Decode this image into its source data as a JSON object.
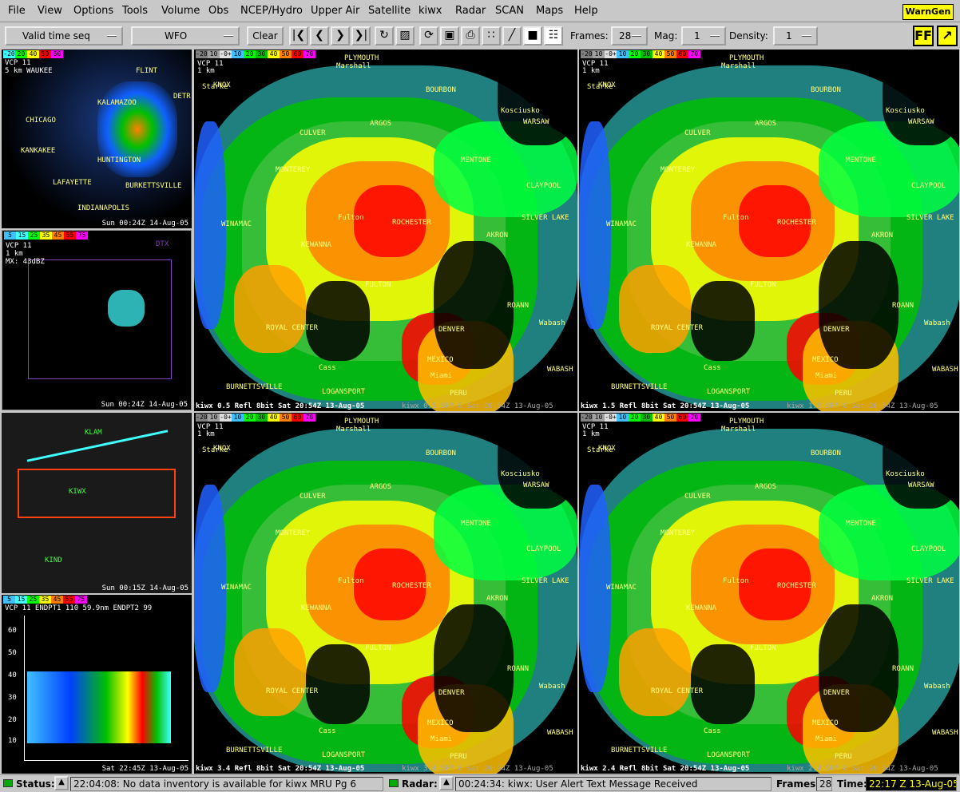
{
  "menu": [
    "File",
    "View",
    "Options",
    "Tools",
    "Volume",
    "Obs",
    "NCEP/Hydro",
    "Upper Air",
    "Satellite",
    "kiwx",
    "Radar",
    "SCAN",
    "Maps",
    "Help"
  ],
  "warngen": "WarnGen",
  "toolbar": {
    "valid_time": "Valid time seq",
    "scale": "WFO",
    "clear": "Clear",
    "frames_label": "Frames:",
    "frames_value": "28",
    "mag_label": "Mag:",
    "mag_value": "1",
    "density_label": "Density:",
    "density_value": "1",
    "ff_label": "FF"
  },
  "icons": [
    "first-frame-icon",
    "prev-frame-icon",
    "next-frame-icon",
    "last-frame-icon",
    "loop-icon",
    "image-props-icon",
    "refresh-icon",
    "display-props-icon",
    "print-icon",
    "points-icon",
    "baselines-icon",
    "single-panel-icon",
    "four-panel-icon"
  ],
  "colorbar": {
    "refl": [
      "-20",
      "10",
      "-0+",
      "10",
      "20",
      "30",
      "40",
      "50",
      "60",
      "70"
    ],
    "small": [
      "5",
      "15",
      "25",
      "35",
      "45",
      "55",
      "75"
    ]
  },
  "side_panels": [
    {
      "footer": "Sun 00:24Z 14-Aug-05",
      "labels": [
        "VCP 11",
        "5 km WAUKEE",
        "FLINT",
        "KALAMAZOO",
        "DETR",
        "CHICAGO",
        "KANKAKEE",
        "HUNTINGTON",
        "LAFAYETTE",
        "BURKETTSVILLE",
        "INDIANAPOLIS"
      ]
    },
    {
      "footer": "Sun 00:24Z 14-Aug-05",
      "labels": [
        "VCP 11",
        "1 km",
        "MX: 43dBZ",
        "DTX"
      ]
    },
    {
      "footer": "Sun 00:15Z 14-Aug-05",
      "labels": [
        "KLAM",
        "KIWX",
        "KIND"
      ]
    },
    {
      "footer": "Sat 22:45Z 13-Aug-05",
      "labels": [
        "VCP 11  ENDPT1 110  59.9nm  ENDPT2  99"
      ],
      "yticks": [
        "60",
        "50",
        "40",
        "30",
        "20",
        "10"
      ]
    }
  ],
  "radar_panels": [
    {
      "footer": "kiwx 0.5 Refl   8bit Sat 20:54Z 13-Aug-05",
      "footer2": "kiwx 0.5 SRM 8  Sat 20:54Z 13-Aug-05",
      "vcp": "VCP 11",
      "res": "1 km"
    },
    {
      "footer": "kiwx 1.5 Refl   8bit Sat 20:54Z 13-Aug-05",
      "footer2": "kiwx 1.5 SRM 8  Sat 20:54Z 13-Aug-05",
      "vcp": "VCP 11",
      "res": "1 km"
    },
    {
      "footer": "kiwx 3.4 Refl   8bit Sat 20:54Z 13-Aug-05",
      "footer2": "kiwx 3.4 SRM 8  Sat 20:54Z 13-Aug-05",
      "vcp": "VCP 11",
      "res": "1 km"
    },
    {
      "footer": "kiwx 2.4 Refl   8bit Sat 20:54Z 13-Aug-05",
      "footer2": "kiwx 2.4 SRM 8  Sat 20:54Z 13-Aug-05",
      "vcp": "VCP 11",
      "res": "1 km"
    }
  ],
  "places": [
    "PLYMOUTH",
    "Marshall",
    "Starke",
    "KNOX",
    "BOURBON",
    "Kosciusko",
    "WARSAW",
    "ARGOS",
    "CULVER",
    "MONTEREY",
    "MENTONE",
    "CLAYPOOL",
    "WINAMAC",
    "Fulton",
    "ROCHESTER",
    "SILVER LAKE",
    "KEWANNA",
    "AKRON",
    "FULTON",
    "ROANN",
    "ROYAL CENTER",
    "DENVER",
    "Wabash",
    "MEXICO",
    "Cass",
    "Miami",
    "WABASH",
    "BURNETTSVILLE",
    "LOGANSPORT",
    "PERU"
  ],
  "status": {
    "status_label": "Status:",
    "status_text": "22:04:08: No data inventory is available for kiwx MRU Pg 6",
    "radar_label": "Radar:",
    "radar_text": "00:24:34: kiwx: User Alert Text Message Received",
    "frames_label": "Frames:",
    "frames_value": "28",
    "time_label": "Time:",
    "time_value": "22:17 Z 13-Aug-05"
  },
  "colors": {
    "accent": "#ffff00",
    "bg": "#c8c8c8",
    "map": "#000000"
  }
}
